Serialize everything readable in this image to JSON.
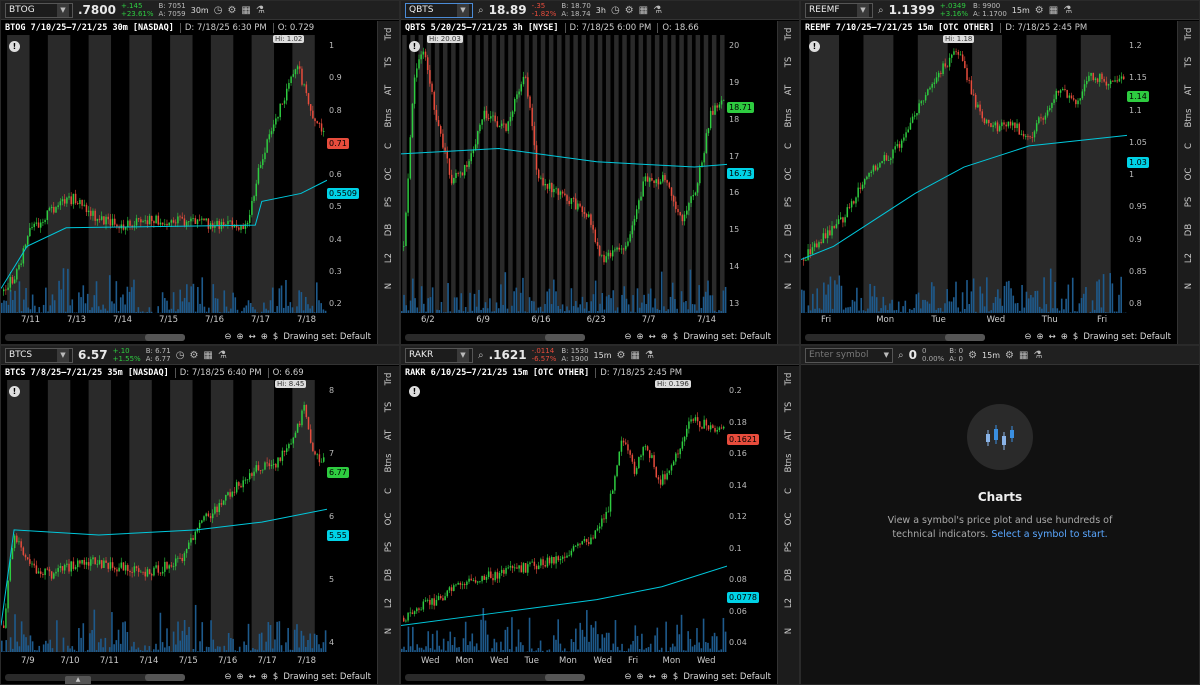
{
  "panes": [
    {
      "symbol": "BTOG",
      "last": ".7800",
      "chg": "+.145",
      "chg_pct": "+23.61%",
      "bid": "B: 7051",
      "ask": "A: 7059",
      "aggregation": "30m",
      "title": "BTOG 7/10/25–7/21/25 30m [NASDAQ]",
      "date": "D: 7/18/25 6:30 PM",
      "open": "O: 0.729",
      "hi_label": "Hi: 1.02",
      "yticks": [
        "1",
        "0.9",
        "0.8",
        "0.7",
        "0.6",
        "0.5",
        "0.4",
        "0.3",
        "0.2"
      ],
      "price_tag": "0.71",
      "vwap_tag": "0.5509",
      "xticks": [
        "7/11",
        "7/13",
        "7/14",
        "7/15",
        "7/16",
        "7/17",
        "7/18"
      ],
      "drawing_set": "Drawing set: Default",
      "sidetabs": [
        "Trd",
        "TS",
        "AT",
        "Btns",
        "C",
        "OC",
        "PS",
        "DB",
        "L2",
        "N"
      ],
      "colors": {
        "price_tag": "#e74c3c",
        "vwap_tag": "#00d2e6"
      }
    },
    {
      "symbol": "QBTS",
      "last": "18.89",
      "chg": "-.35",
      "chg_pct": "-1.82%",
      "bid": "B: 18.70",
      "ask": "A: 18.74",
      "aggregation": "3h",
      "title": "QBTS 5/20/25–7/21/25 3h [NYSE]",
      "date": "D: 7/18/25 6:00 PM",
      "open": "O: 18.66",
      "hi_label": "Hi: 20.03",
      "yticks": [
        "20",
        "19",
        "18",
        "17",
        "16",
        "15",
        "14",
        "13"
      ],
      "price_tag": "18.71",
      "vwap_tag": "16.73",
      "xticks": [
        "6/2",
        "6/9",
        "6/16",
        "6/23",
        "7/7",
        "7/14"
      ],
      "drawing_set": "Drawing set: Default",
      "sidetabs": [
        "Trd",
        "TS",
        "AT",
        "Btns",
        "C",
        "OC",
        "PS",
        "DB",
        "L2",
        "N"
      ],
      "colors": {
        "price_tag": "#2ecc40",
        "vwap_tag": "#00d2e6"
      }
    },
    {
      "symbol": "REEMF",
      "last": "1.1399",
      "chg": "+.0349",
      "chg_pct": "+3.16%",
      "bid": "B: 9900",
      "ask": "A: 1.1700",
      "aggregation": "15m",
      "title": "REEMF 7/10/25–7/21/25 15m [OTC OTHER]",
      "date": "D: 7/18/25 2:45 PM",
      "hi_label": "Hi: 1.18",
      "yticks": [
        "1.2",
        "1.15",
        "1.1",
        "1.05",
        "1",
        "0.95",
        "0.9",
        "0.85",
        "0.8"
      ],
      "price_tag": "1.14",
      "vwap_tag": "1.03",
      "xticks": [
        "Fri",
        "Mon",
        "Tue",
        "Wed",
        "Thu",
        "Fri"
      ],
      "drawing_set": "Drawing set: Default",
      "sidetabs": [
        "Trd",
        "TS",
        "AT",
        "Btns",
        "C",
        "OC",
        "PS",
        "DB",
        "L2",
        "N"
      ],
      "colors": {
        "price_tag": "#2ecc40",
        "vwap_tag": "#00d2e6"
      }
    },
    {
      "symbol": "BTCS",
      "last": "6.57",
      "chg": "+.10",
      "chg_pct": "+1.55%",
      "bid": "B: 6.71",
      "ask": "A: 6.77",
      "aggregation": "",
      "title": "BTCS 7/8/25–7/21/25 35m [NASDAQ]",
      "date": "D: 7/18/25 6:40 PM",
      "open": "O: 6.69",
      "hi_label": "Hi: 8.45",
      "yticks": [
        "8",
        "7",
        "6",
        "5",
        "4"
      ],
      "price_tag": "6.77",
      "vwap_tag": "5.55",
      "xticks": [
        "7/9",
        "7/10",
        "7/11",
        "7/14",
        "7/15",
        "7/16",
        "7/17",
        "7/18"
      ],
      "drawing_set": "Drawing set: Default",
      "sidetabs": [
        "Trd",
        "TS",
        "AT",
        "Btns",
        "C",
        "OC",
        "PS",
        "DB",
        "L2",
        "N"
      ],
      "colors": {
        "price_tag": "#2ecc40",
        "vwap_tag": "#00d2e6"
      }
    },
    {
      "symbol": "RAKR",
      "last": ".1621",
      "chg": "-.0114",
      "chg_pct": "-6.57%",
      "bid": "B: 1530",
      "ask": "A: 1900",
      "aggregation": "15m",
      "title": "RAKR 6/10/25–7/21/25 15m [OTC OTHER]",
      "date": "D: 7/18/25 2:45 PM",
      "hi_label": "Hi: 0.196",
      "yticks": [
        "0.2",
        "0.18",
        "0.16",
        "0.14",
        "0.12",
        "0.1",
        "0.08",
        "0.06",
        "0.04"
      ],
      "price_tag": "0.1621",
      "vwap_tag": "0.0778",
      "xticks": [
        "Wed",
        "Mon",
        "Wed",
        "Tue",
        "Mon",
        "Wed",
        "Fri",
        "Mon",
        "Wed"
      ],
      "drawing_set": "Drawing set: Default",
      "sidetabs": [
        "Trd",
        "TS",
        "AT",
        "Btns",
        "C",
        "OC",
        "PS",
        "DB",
        "L2",
        "N"
      ],
      "colors": {
        "price_tag": "#e74c3c",
        "vwap_tag": "#00d2e6"
      }
    }
  ],
  "empty_pane": {
    "placeholder": "Enter symbol",
    "last": "0",
    "chg": "0",
    "chg_pct": "0.00%",
    "bid": "B: 0",
    "ask": "A: 0",
    "aggregation": "15m",
    "title": "Charts",
    "desc1": "View a symbol's price plot and use hundreds of",
    "desc2": "technical indicators.",
    "link": "Select a symbol to start."
  }
}
